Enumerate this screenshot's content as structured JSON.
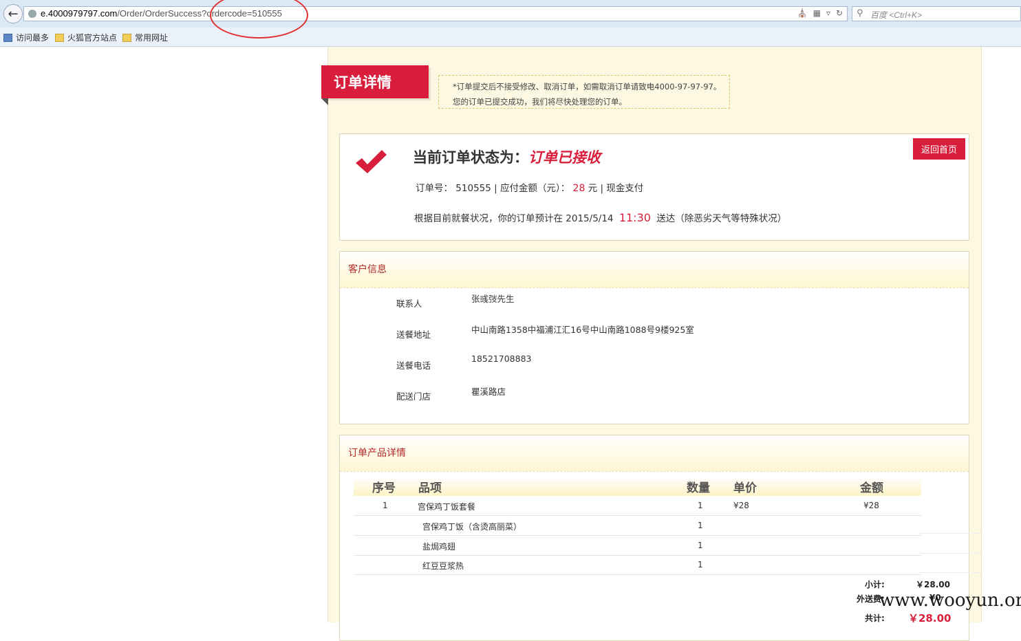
{
  "browser": {
    "url_host": "e.4000979797.com",
    "url_path": "/Order/OrderSuccess?ordercode=510555",
    "search_placeholder": "百度 <Ctrl+K>",
    "bookmarks": [
      "访问最多",
      "火狐官方站点",
      "常用网址"
    ]
  },
  "page": {
    "ribbon_title": "订单详情",
    "notice_line1": "*订单提交后不接受修改、取消订单，如需取消订单请致电4000-97-97-97。",
    "notice_line2": "您的订单已提交成功，我们将尽快处理您的订单。",
    "status": {
      "label": "当前订单状态为：",
      "value": "订单已接收",
      "home_button": "返回首页",
      "order_no_label": "订单号：",
      "order_no": "510555",
      "amount_label": "应付金额（元）：",
      "amount": "28",
      "amount_unit": "元",
      "pay_method": "现金支付",
      "eta_prefix": "根据目前就餐状况，你的订单预计在 2015/5/14",
      "eta_time": "11:30",
      "eta_suffix": "送达（除恶劣天气等特殊状况）"
    },
    "customer": {
      "title": "客户信息",
      "rows": [
        {
          "label": "联系人",
          "value": "张彧弢先生"
        },
        {
          "label": "送餐地址",
          "value": "中山南路1358中福浦江汇16号中山南路1088号9楼925室"
        },
        {
          "label": "送餐电话",
          "value": "18521708883"
        },
        {
          "label": "配送门店",
          "value": "瞿溪路店"
        }
      ]
    },
    "products": {
      "title": "订单产品详情",
      "headers": {
        "seq": "序号",
        "item": "品项",
        "qty": "数量",
        "price": "单价",
        "amount": "金额"
      },
      "rows": [
        {
          "seq": "1",
          "item": "宫保鸡丁饭套餐",
          "qty": "1",
          "price": "¥28",
          "amount": "¥28"
        },
        {
          "seq": "",
          "item": "宫保鸡丁饭（含烫高丽菜）",
          "qty": "1",
          "price": "",
          "amount": ""
        },
        {
          "seq": "",
          "item": "盐焗鸡翅",
          "qty": "1",
          "price": "",
          "amount": ""
        },
        {
          "seq": "",
          "item": "红豆豆浆热",
          "qty": "1",
          "price": "",
          "amount": ""
        }
      ],
      "subtotal_label": "小计:",
      "subtotal": "￥28.00",
      "delivery_label": "外送费:",
      "delivery": "¥0",
      "total_label": "共计:",
      "total": "￥28.00"
    }
  },
  "watermark": "www.wooyun.org",
  "colors": {
    "brand_red": "#d81e3a",
    "page_bg": "#fdf8e1"
  }
}
